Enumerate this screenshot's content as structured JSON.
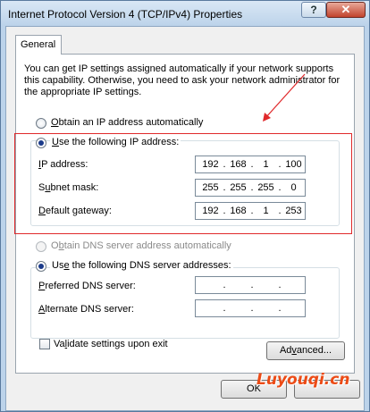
{
  "window": {
    "title": "Internet Protocol Version 4 (TCP/IPv4) Properties",
    "help_glyph": "?",
    "close_glyph": "✕"
  },
  "tabs": [
    {
      "label": "General",
      "active": true
    }
  ],
  "description": "You can get IP settings assigned automatically if your network supports this capability. Otherwise, you need to ask your network administrator for the appropriate IP settings.",
  "ip_mode": {
    "auto": {
      "label_key": "O",
      "label_rest": "btain an IP address automatically",
      "checked": false
    },
    "manual": {
      "label_key": "U",
      "label_rest": "se the following IP address:",
      "checked": true
    }
  },
  "ip_fields": {
    "ip_address": {
      "label_key": "I",
      "label_rest": "P address:",
      "octets": [
        "192",
        "168",
        "1",
        "100"
      ]
    },
    "subnet_mask": {
      "label_pre": "S",
      "label_key": "u",
      "label_rest": "bnet mask:",
      "octets": [
        "255",
        "255",
        "255",
        "0"
      ]
    },
    "default_gateway": {
      "label_key": "D",
      "label_rest": "efault gateway:",
      "octets": [
        "192",
        "168",
        "1",
        "253"
      ]
    }
  },
  "dns_mode": {
    "auto": {
      "label_pre": "O",
      "label_key": "b",
      "label_rest": "tain DNS server address automatically",
      "checked": false,
      "disabled": true
    },
    "manual": {
      "label_pre": "Us",
      "label_key": "e",
      "label_rest": " the following DNS server addresses:",
      "checked": true
    }
  },
  "dns_fields": {
    "preferred": {
      "label_key": "P",
      "label_rest": "referred DNS server:",
      "octets": [
        "",
        "",
        "",
        ""
      ],
      "dots": "."
    },
    "alternate": {
      "label_key": "A",
      "label_rest": "lternate DNS server:",
      "octets": [
        "",
        "",
        "",
        ""
      ],
      "dots": "."
    }
  },
  "validate": {
    "label_pre": "Va",
    "label_key": "l",
    "label_rest": "idate settings upon exit",
    "checked": false
  },
  "buttons": {
    "advanced_pre": "Ad",
    "advanced_key": "v",
    "advanced_rest": "anced...",
    "ok": "OK"
  },
  "annotation": {
    "box_color": "#e0292b",
    "arrow_color": "#e0292b"
  },
  "watermark": "Luyouqi.cn"
}
